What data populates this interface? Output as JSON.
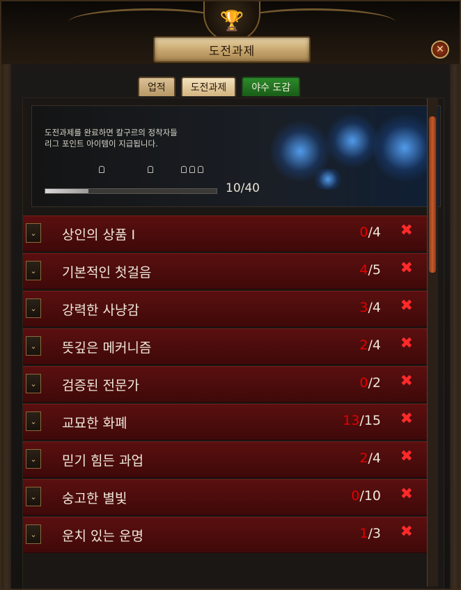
{
  "window": {
    "title": "도전과제",
    "close_icon": "close-icon"
  },
  "tabs": [
    {
      "label": "업적",
      "active": false
    },
    {
      "label": "도전과제",
      "active": true
    },
    {
      "label": "야수 도감",
      "active": false
    }
  ],
  "banner": {
    "description_line1": "도전과제를 완료하면 칼구르의 정착자들",
    "description_line2": "리그 포인트 아이템이 지급됩니다.",
    "progress": {
      "completed": 10,
      "total": 40,
      "label": "10/40"
    }
  },
  "challenges": [
    {
      "name": "상인의 상품 I",
      "done": "0",
      "total": "/4"
    },
    {
      "name": "기본적인 첫걸음",
      "done": "4",
      "total": "/5"
    },
    {
      "name": "강력한 사냥감",
      "done": "3",
      "total": "/4"
    },
    {
      "name": "뜻깊은 메커니즘",
      "done": "2",
      "total": "/4"
    },
    {
      "name": "검증된 전문가",
      "done": "0",
      "total": "/2"
    },
    {
      "name": "교묘한 화폐",
      "done": "13",
      "total": "/15"
    },
    {
      "name": "믿기 힘든 과업",
      "done": "2",
      "total": "/4"
    },
    {
      "name": "숭고한 별빛",
      "done": "0",
      "total": "/10"
    },
    {
      "name": "운치 있는 운명",
      "done": "1",
      "total": "/3"
    }
  ],
  "colors": {
    "accent_red": "#e60000",
    "row_bg": "#5a0f0f",
    "tab_green": "#1a5c18",
    "gold": "#c6a463"
  },
  "icons": {
    "header": "trophy-icon",
    "row_toggle": "chevron-down-icon",
    "row_status": "x-mark-icon"
  }
}
